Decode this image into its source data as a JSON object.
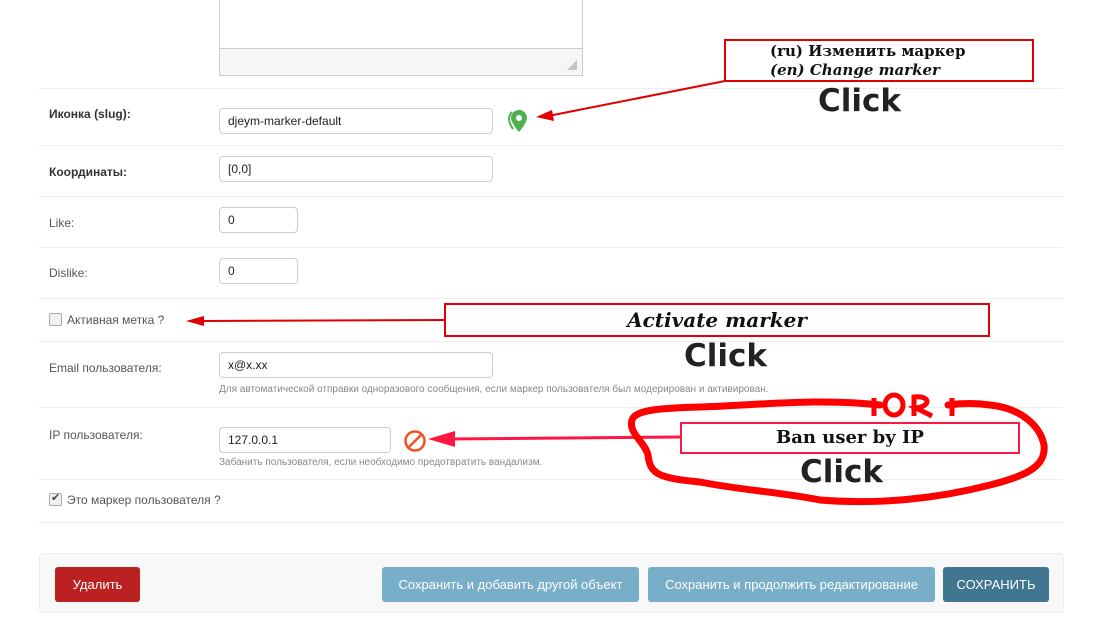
{
  "form": {
    "icon_field": {
      "label": "Иконка (slug):",
      "value": "djeym-marker-default"
    },
    "coords_field": {
      "label": "Координаты:",
      "value": "[0,0]"
    },
    "like_field": {
      "label": "Like:",
      "value": "0"
    },
    "dislike_field": {
      "label": "Dislike:",
      "value": "0"
    },
    "active_checkbox": {
      "label": "Активная метка ?",
      "checked": false
    },
    "email_field": {
      "label": "Email пользователя:",
      "value": "x@x.xx",
      "help": "Для автоматической отправки одноразового сообщения, если маркер пользователя был модерирован и активирован."
    },
    "ip_field": {
      "label": "IP пользователя:",
      "value": "127.0.0.1",
      "help": "Забанить пользователя, если необходимо предотвратить вандализм."
    },
    "user_marker_checkbox": {
      "label": "Это маркер пользователя ?",
      "checked": true
    }
  },
  "icons": {
    "marker": "map-marker-icon",
    "ban": "ban-icon"
  },
  "colors": {
    "marker_icon": "#4caf50",
    "ban_icon": "#f4511e",
    "annotation_red": "#e00000",
    "annotation_pink": "#ff1744",
    "delete_button": "#ba2121",
    "secondary_button": "#79aec8",
    "save_button": "#417690"
  },
  "submit_row": {
    "delete_label": "Удалить",
    "save_add_label": "Сохранить и добавить другой объект",
    "save_continue_label": "Сохранить и продолжить редактирование",
    "save_label": "СОХРАНИТЬ"
  },
  "annotations": {
    "change_marker_ru": "(ru) Изменить маркер",
    "change_marker_en": "(en) Change marker",
    "activate_marker": "Activate marker",
    "ban_user": "Ban user by IP",
    "click": "Click",
    "or_mark": "OR"
  }
}
